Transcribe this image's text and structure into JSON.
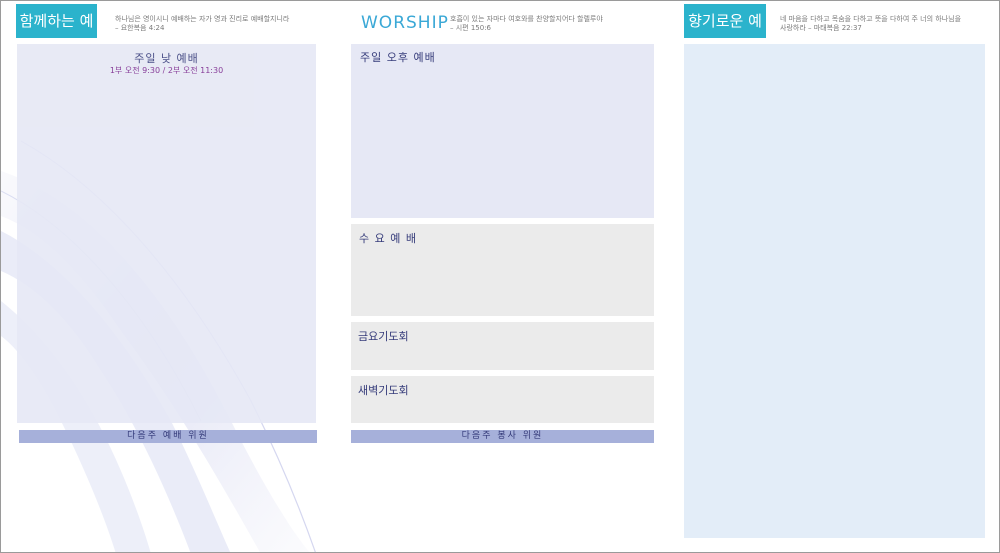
{
  "left": {
    "badge": "함께하는 예배",
    "verse_line1": "하나님은 영이시니 예배하는 자가 영과 진리로 예배할지니라",
    "verse_line2": "– 요한복음 4:24",
    "panel_title": "주일 낮 예배",
    "panel_sub": "1부 오전 9:30 / 2부 오전 11:30",
    "footer": "다음주 예배 위원"
  },
  "center": {
    "heading": "WORSHIP",
    "verse_line1": "호흡이 있는 자마다 여호와를 찬양할지어다 할렐루야",
    "verse_line2": "– 시편 150:6",
    "sunday_pm": "주일 오후 예배",
    "wednesday": "수 요 예 배",
    "friday": "금요기도회",
    "dawn": "새벽기도회",
    "footer": "다음주 봉사 위원"
  },
  "right": {
    "badge": "향기로운 예물",
    "verse_line1": "네 마음을 다하고 목숨을 다하고 뜻을 다하여 주 너의 하나님을",
    "verse_line2": "사랑하라 – 마태복음 22:37"
  },
  "colors": {
    "badge": "#2bb3cc",
    "panel_lavender": "#e6e8f5",
    "panel_gray": "#ebebeb",
    "panel_blue": "#e3edf8",
    "footer_bar": "#a6b0da",
    "title_text": "#353b7a",
    "sub_text": "#7b2a8f"
  }
}
